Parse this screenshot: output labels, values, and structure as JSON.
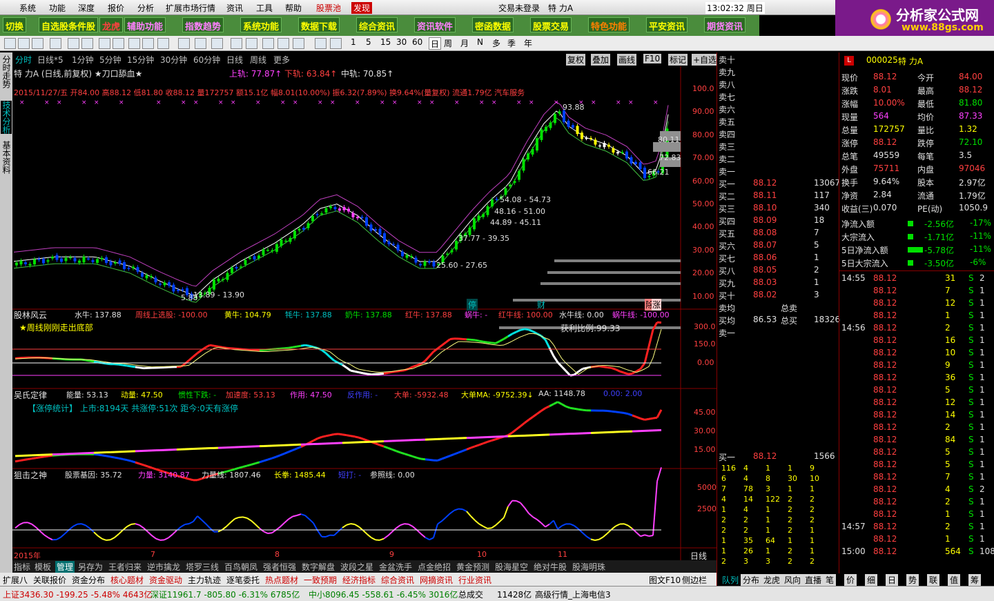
{
  "menu": [
    "系统",
    "功能",
    "深度",
    "报价",
    "分析",
    "扩展市场行情",
    "资讯",
    "工具",
    "帮助",
    "股票池",
    "发现"
  ],
  "menu_status": {
    "login": "交易未登录",
    "name": "特 力A",
    "time": "13:02:32 周日"
  },
  "logo_text": "分析家公式网",
  "logo_url": "www.88gs.com",
  "toolbar1": [
    "切换",
    "自选股条件股",
    "龙虎",
    "辅助功能",
    "指数趋势",
    "系统功能",
    "数据下载",
    "综合资讯",
    "资讯软件",
    "密函数据",
    "股票交易",
    "特色功能",
    "平安资讯",
    "期货资讯"
  ],
  "toolbar2_periods": [
    "1",
    "5",
    "15",
    "30",
    "60",
    "日",
    "周",
    "月",
    "N",
    "多",
    "季",
    "年"
  ],
  "tabs": [
    "分时",
    "日线*5",
    "1分钟",
    "5分钟",
    "15分钟",
    "30分钟",
    "60分钟",
    "日线",
    "周线",
    "更多"
  ],
  "tabs_right": [
    "复权",
    "叠加",
    "画线",
    "F10",
    "标记",
    "+自选"
  ],
  "left_tabs": [
    "分时走势",
    "技术分析",
    "基本资料"
  ],
  "main": {
    "title": "特 力A (日线,前复权) ★刀口舔血★",
    "upper": "上轨: 77.87↑",
    "lower": "下轨: 63.84↑",
    "mid": "中轨: 70.85↑",
    "info": "2015/11/27/五 开84.00 高88.12 低81.80 收88.12 量172757 额15.1亿 幅8.01(10.00%) 振6.32(7.89%) 换9.64%(量复权) 流通1.79亿 汽车服务",
    "yaxis": [
      "100.0",
      "90.00",
      "80.00",
      "70.00",
      "60.00",
      "50.00",
      "40.00",
      "30.00",
      "20.00",
      "10.00"
    ],
    "ranges": [
      "54.08 - 54.73",
      "48.16 - 51.00",
      "44.89 - 45.11",
      "37.77 - 39.35",
      "25.60 - 27.65",
      "13.89 - 13.90"
    ],
    "labels": {
      "high": "93.88",
      "a": "80.11",
      "b": "72.83",
      "c": "66.21",
      "bottom": "5.88"
    },
    "markers": [
      "停",
      "财",
      "除",
      "涨"
    ]
  },
  "ind1": {
    "title": "股林风云",
    "fields": [
      "水牛: 137.88",
      "周线上选股: -100.00",
      "黄牛: 104.79",
      "牦牛: 137.88",
      "奶牛: 137.88",
      "红牛: 137.88",
      "蜗牛: -",
      "红牛线: 100.00",
      "水牛线: 0.00",
      "蜗牛线: -100.00"
    ],
    "note": "★周线刚刚走出底部",
    "ratio": "获利比例:99.33",
    "yaxis": [
      "300.0",
      "150.0",
      "0.00"
    ]
  },
  "ind2": {
    "title": "吴氏定律",
    "fields": [
      "能量: 53.13",
      "动量: 47.50",
      "惯性下跌: -",
      "加速度: 53.13",
      "作用: 47.50",
      "反作用: -",
      "大单: -5932.48",
      "大单MA: -9752.39↓",
      "AA: 1148.78",
      "0.00: 2.00"
    ],
    "stat": "【涨停统计】 上市:8194天 共涨停:51次 距今:0天有涨停",
    "yaxis": [
      "45.00",
      "30.00",
      "15.00"
    ]
  },
  "ind3": {
    "title": "狙击之神",
    "fields": [
      "股票基因: 35.72",
      "力量: 3140.87",
      "力量线: 1807.46",
      "长拳: 1485.44",
      "短打: -",
      "参照线: 0.00"
    ],
    "yaxis": [
      "5000",
      "2500"
    ]
  },
  "timeaxis": [
    "2015年",
    "7",
    "8",
    "9",
    "10",
    "11",
    "日线"
  ],
  "bottom_tabs": [
    "指标",
    "模板",
    "管理",
    "另存为",
    "王者归来",
    "逆市擒龙",
    "塔罗三线",
    "百鸟朝凤",
    "强者恒强",
    "数字解盘",
    "波段之星",
    "金盆洗手",
    "点金绝招",
    "黄金预测",
    "股海星空",
    "绝对牛股",
    "股海明珠"
  ],
  "bottom_tabs2": [
    "扩展八",
    "关联报价",
    "资金分布",
    "核心题材",
    "资金驱动",
    "主力轨迹",
    "逐笔委托",
    "热点题材",
    "一致预期",
    "经济指标",
    "综合资讯",
    "网摘资讯",
    "行业资讯",
    "图文F10",
    "侧边栏"
  ],
  "status": {
    "sh": "上证3436.30 -199.25 -5.48% 4643亿",
    "sz": "深证11961.7 -805.80 -6.31% 6785亿",
    "zx": "中小8096.45 -558.61 -6.45% 3016亿",
    "total": "总成交",
    "amount": "11428亿",
    "feed": "高级行情_上海电信3"
  },
  "right": {
    "code": "000025",
    "name": "特 力A",
    "sells": [
      "卖十",
      "卖九",
      "卖八",
      "卖七",
      "卖六",
      "卖五",
      "卖四",
      "卖三",
      "卖二",
      "卖一"
    ],
    "buys": [
      [
        "买一",
        "88.12",
        "13067"
      ],
      [
        "买二",
        "88.11",
        "117"
      ],
      [
        "买三",
        "88.10",
        "340"
      ],
      [
        "买四",
        "88.09",
        "18"
      ],
      [
        "买五",
        "88.08",
        "7"
      ],
      [
        "买六",
        "88.07",
        "5"
      ],
      [
        "买七",
        "88.06",
        "1"
      ],
      [
        "买八",
        "88.05",
        "2"
      ],
      [
        "买九",
        "88.03",
        "1"
      ],
      [
        "买十",
        "88.02",
        "3"
      ]
    ],
    "avg": [
      [
        "卖均",
        "",
        "总卖",
        ""
      ],
      [
        "买均",
        "86.53",
        "总买",
        "18326"
      ]
    ],
    "quote": [
      [
        "现价",
        "88.12",
        "今开",
        "84.00"
      ],
      [
        "涨跌",
        "8.01",
        "最高",
        "88.12"
      ],
      [
        "涨幅",
        "10.00%",
        "最低",
        "81.80"
      ],
      [
        "现量",
        "564",
        "均价",
        "87.33"
      ],
      [
        "总量",
        "172757",
        "量比",
        "1.32"
      ],
      [
        "涨停",
        "88.12",
        "跌停",
        "72.10"
      ],
      [
        "总笔",
        "49559",
        "每笔",
        "3.5"
      ],
      [
        "外盘",
        "75711",
        "内盘",
        "97046"
      ],
      [
        "换手",
        "9.64%",
        "股本",
        "2.97亿"
      ],
      [
        "净资",
        "2.84",
        "流通",
        "1.79亿"
      ],
      [
        "收益(三)",
        "0.070",
        "PE(动)",
        "1050.9"
      ]
    ],
    "flows": [
      [
        "净流入额",
        "-2.56亿",
        "-17%"
      ],
      [
        "大宗流入",
        "-1.71亿",
        "-11%"
      ],
      [
        "5日净流入额",
        "-5.78亿",
        "-11%"
      ],
      [
        "5日大宗流入",
        "-3.50亿",
        "-6%"
      ]
    ],
    "ticks": [
      [
        "14:55",
        "88.12",
        "31",
        "S",
        "2"
      ],
      [
        "",
        "88.12",
        "7",
        "S",
        "1"
      ],
      [
        "",
        "88.12",
        "12",
        "S",
        "1"
      ],
      [
        "",
        "88.12",
        "1",
        "S",
        "1"
      ],
      [
        "14:56",
        "88.12",
        "2",
        "S",
        "1"
      ],
      [
        "",
        "88.12",
        "16",
        "S",
        "1"
      ],
      [
        "",
        "88.12",
        "10",
        "S",
        "1"
      ],
      [
        "",
        "88.12",
        "9",
        "S",
        "1"
      ],
      [
        "",
        "88.12",
        "36",
        "S",
        "1"
      ],
      [
        "",
        "88.12",
        "5",
        "S",
        "1"
      ],
      [
        "",
        "88.12",
        "12",
        "S",
        "1"
      ],
      [
        "",
        "88.12",
        "14",
        "S",
        "1"
      ],
      [
        "",
        "88.12",
        "2",
        "S",
        "1"
      ],
      [
        "",
        "88.12",
        "84",
        "S",
        "1"
      ],
      [
        "",
        "88.12",
        "5",
        "S",
        "1"
      ],
      [
        "",
        "88.12",
        "5",
        "S",
        "1"
      ],
      [
        "",
        "88.12",
        "7",
        "S",
        "1"
      ],
      [
        "",
        "88.12",
        "4",
        "S",
        "2"
      ],
      [
        "",
        "88.12",
        "2",
        "S",
        "1"
      ],
      [
        "",
        "88.12",
        "1",
        "S",
        "1"
      ],
      [
        "14:57",
        "88.12",
        "2",
        "S",
        "1"
      ],
      [
        "",
        "88.12",
        "1",
        "S",
        "1"
      ],
      [
        "15:00",
        "88.12",
        "564",
        "S",
        "108"
      ]
    ],
    "queue_head": [
      "买一",
      "88.12",
      "1566"
    ],
    "queue": [
      [
        "116",
        "4",
        "1",
        "1",
        "9"
      ],
      [
        "6",
        "4",
        "8",
        "30",
        "10"
      ],
      [
        "7",
        "78",
        "3",
        "1",
        "1"
      ],
      [
        "4",
        "14",
        "122",
        "2",
        "2"
      ],
      [
        "1",
        "4",
        "1",
        "2",
        "2"
      ],
      [
        "2",
        "2",
        "1",
        "2",
        "2"
      ],
      [
        "2",
        "2",
        "1",
        "2",
        "1"
      ],
      [
        "1",
        "35",
        "64",
        "1",
        "1"
      ],
      [
        "1",
        "26",
        "1",
        "2",
        "1"
      ],
      [
        "2",
        "3",
        "3",
        "2",
        "2"
      ]
    ],
    "bottom_tabs": [
      "队列",
      "分布",
      "龙虎",
      "风向",
      "直播",
      "笔",
      "价",
      "细",
      "日",
      "势",
      "联",
      "值",
      "筹"
    ]
  }
}
